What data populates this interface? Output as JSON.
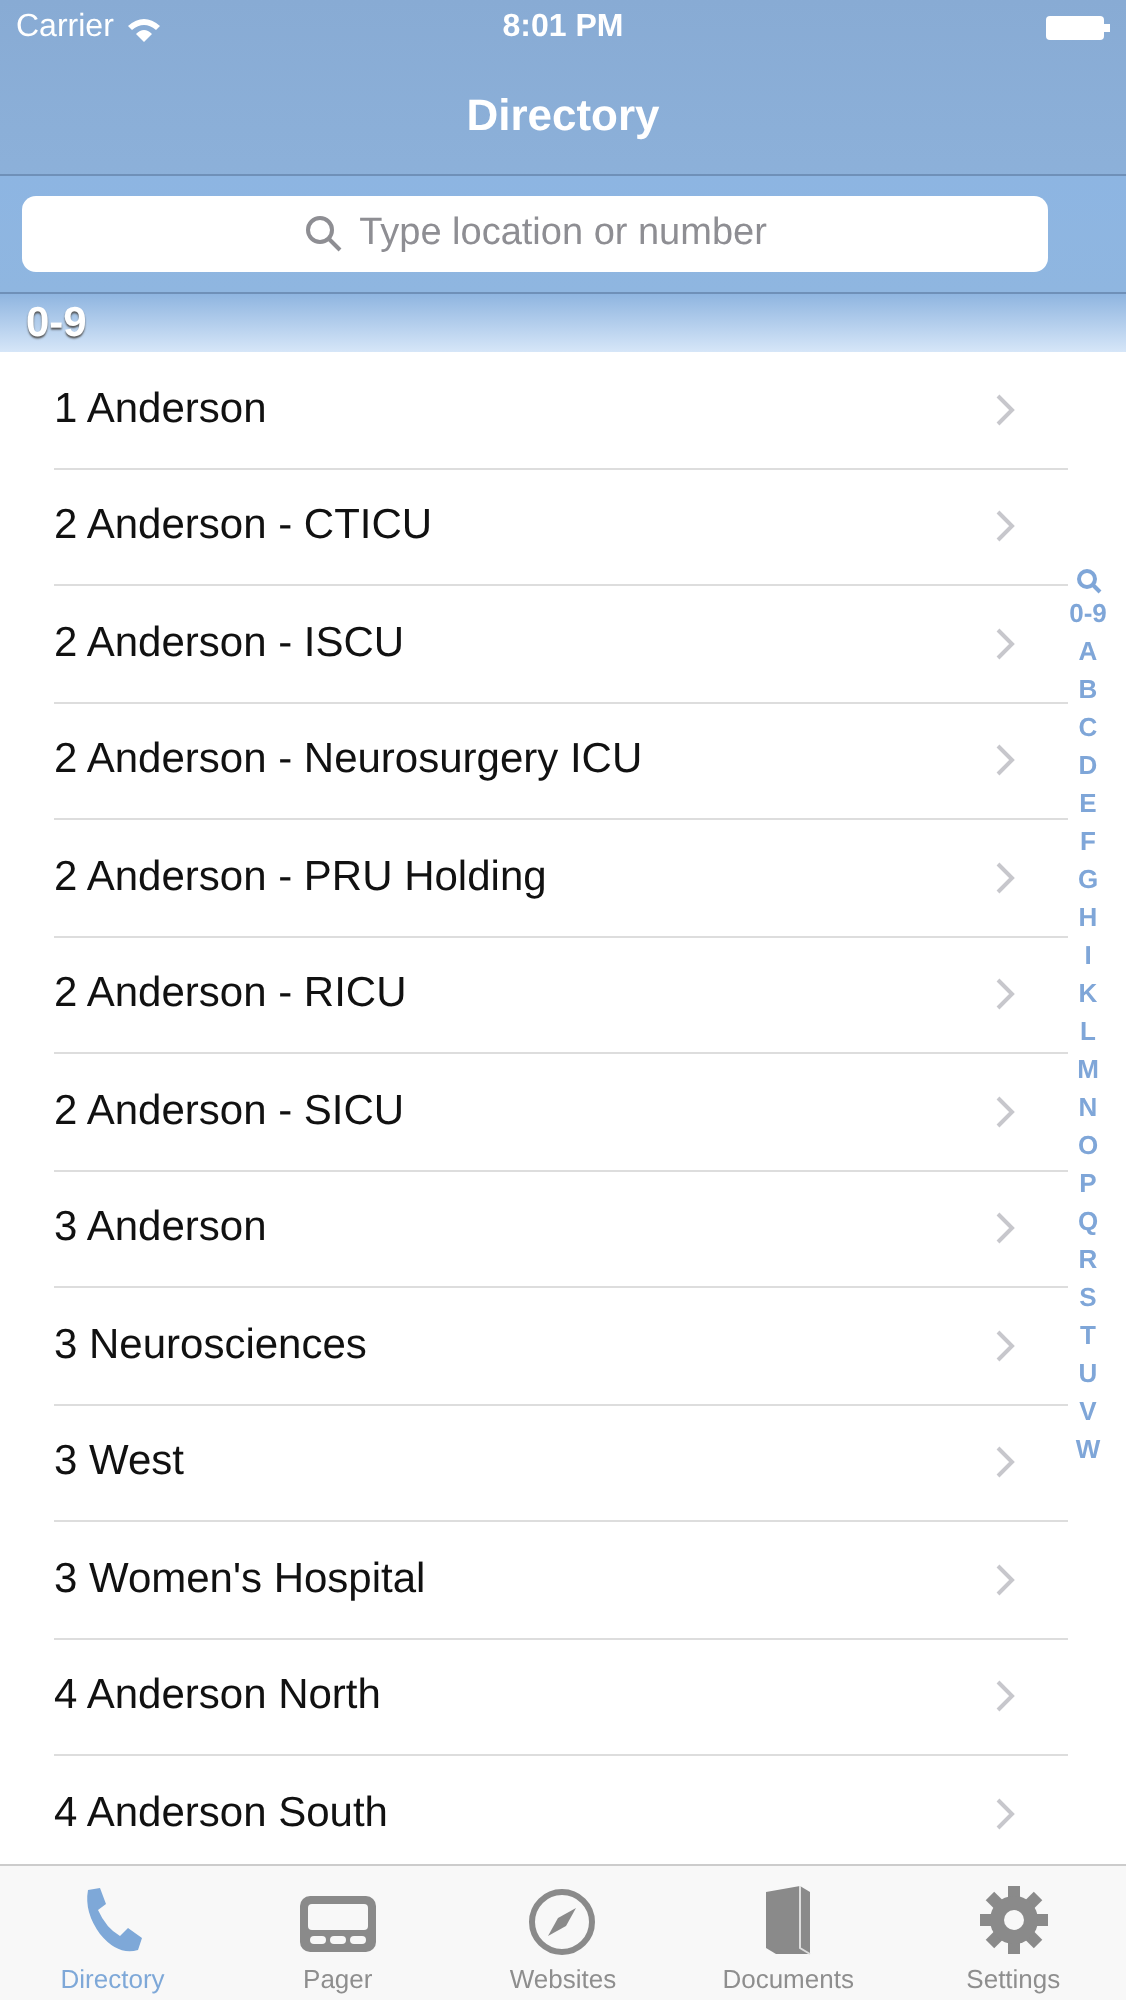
{
  "status_bar": {
    "carrier": "Carrier",
    "time": "8:01 PM"
  },
  "nav": {
    "title": "Directory"
  },
  "search": {
    "placeholder": "Type location or number"
  },
  "section": {
    "title": "0-9"
  },
  "rows": [
    "1 Anderson",
    "2 Anderson - CTICU",
    "2 Anderson - ISCU",
    "2 Anderson - Neurosurgery ICU",
    "2 Anderson - PRU Holding",
    "2 Anderson - RICU",
    "2 Anderson - SICU",
    "3 Anderson",
    "3 Neurosciences",
    "3 West",
    "3 Women's Hospital",
    "4 Anderson North",
    "4 Anderson South"
  ],
  "index": [
    "0-9",
    "A",
    "B",
    "C",
    "D",
    "E",
    "F",
    "G",
    "H",
    "I",
    "K",
    "L",
    "M",
    "N",
    "O",
    "P",
    "Q",
    "R",
    "S",
    "T",
    "U",
    "V",
    "W"
  ],
  "tabs": [
    {
      "label": "Directory",
      "kind": "phone",
      "selected": true
    },
    {
      "label": "Pager",
      "kind": "pager",
      "selected": false
    },
    {
      "label": "Websites",
      "kind": "compass",
      "selected": false
    },
    {
      "label": "Documents",
      "kind": "book",
      "selected": false
    },
    {
      "label": "Settings",
      "kind": "gear",
      "selected": false
    }
  ]
}
